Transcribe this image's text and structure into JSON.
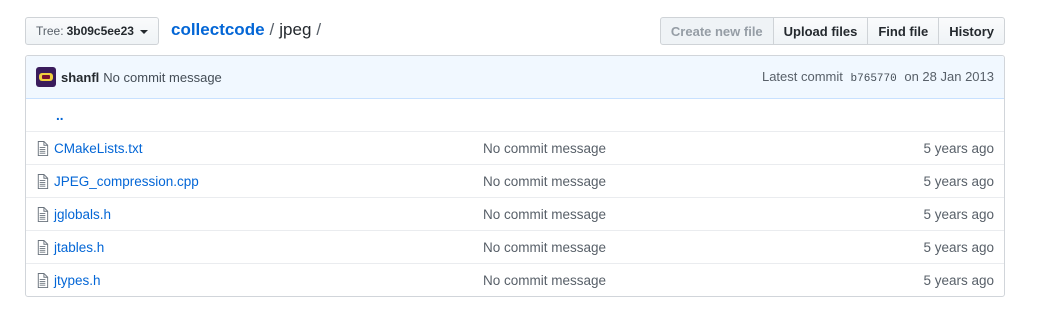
{
  "toolbar": {
    "branch_label": "Tree:",
    "branch_value": "3b09c5ee23",
    "repo": "collectcode",
    "path_sep1": "/",
    "dir": "jpeg",
    "path_sep2": "/",
    "buttons": {
      "create": "Create new file",
      "upload": "Upload files",
      "find": "Find file",
      "history": "History"
    }
  },
  "commit": {
    "author": "shanfl",
    "message": "No commit message",
    "latest_label": "Latest commit",
    "sha": "b765770",
    "date": "on 28 Jan 2013"
  },
  "files": {
    "updir": "..",
    "rows": [
      {
        "name": "CMakeLists.txt",
        "message": "No commit message",
        "age": "5 years ago"
      },
      {
        "name": "JPEG_compression.cpp",
        "message": "No commit message",
        "age": "5 years ago"
      },
      {
        "name": "jglobals.h",
        "message": "No commit message",
        "age": "5 years ago"
      },
      {
        "name": "jtables.h",
        "message": "No commit message",
        "age": "5 years ago"
      },
      {
        "name": "jtypes.h",
        "message": "No commit message",
        "age": "5 years ago"
      }
    ]
  },
  "icons": {
    "file": "file-icon",
    "caret": "caret-down-icon",
    "avatar": "avatar"
  },
  "colors": {
    "link": "#0366d6",
    "commit_bg": "#f1f8ff",
    "border": "#d1d5da"
  }
}
